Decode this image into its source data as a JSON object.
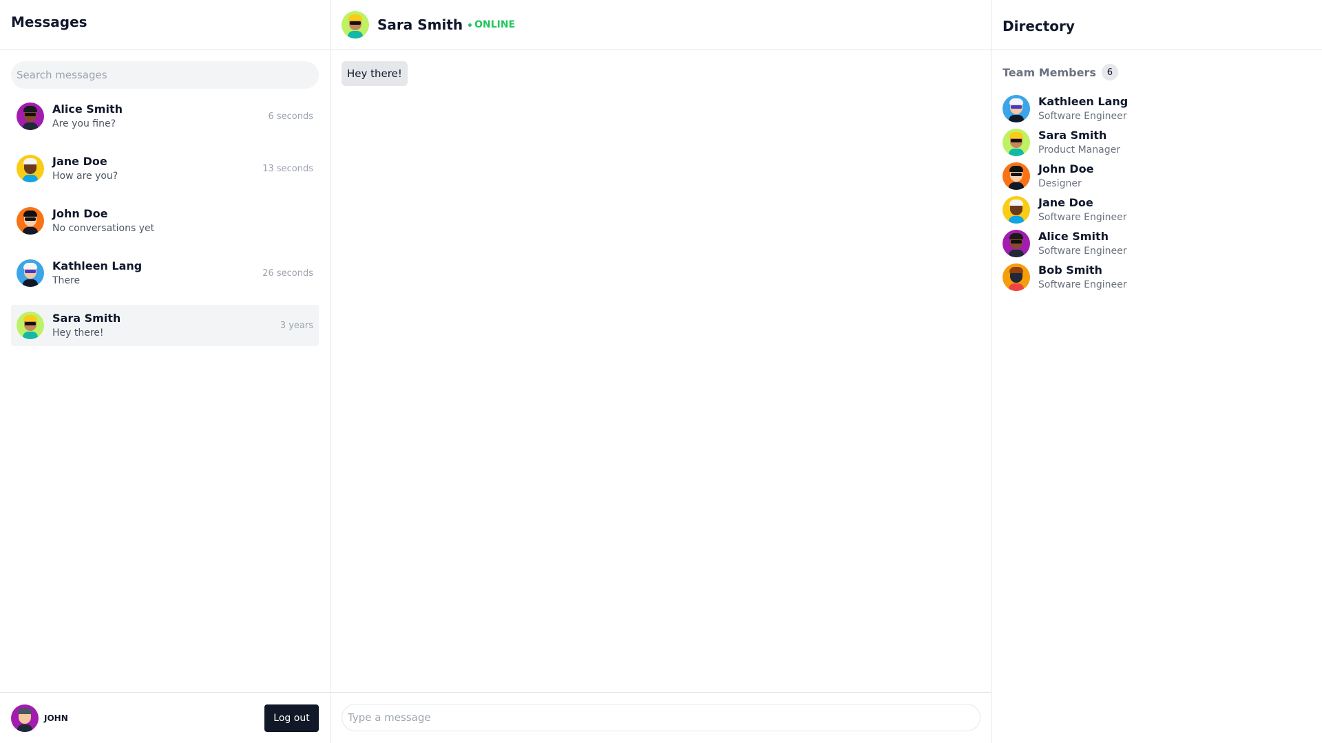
{
  "left": {
    "title": "Messages",
    "search_placeholder": "Search messages",
    "conversations": [
      {
        "name": "Alice Smith",
        "preview": "Are you fine?",
        "time": "6 seconds"
      },
      {
        "name": "Jane Doe",
        "preview": "How are you?",
        "time": "13 seconds"
      },
      {
        "name": "John Doe",
        "preview": "No conversations yet",
        "time": ""
      },
      {
        "name": "Kathleen Lang",
        "preview": "There",
        "time": "26 seconds"
      },
      {
        "name": "Sara Smith",
        "preview": "Hey there!",
        "time": "3 years"
      }
    ],
    "user": {
      "name": "JOHN"
    },
    "logout_label": "Log out"
  },
  "chat": {
    "contact_name": "Sara Smith",
    "status": "ONLINE",
    "messages": [
      {
        "text": "Hey there!"
      }
    ],
    "input_placeholder": "Type a message"
  },
  "directory": {
    "title": "Directory",
    "team_label": "Team Members",
    "team_count": "6",
    "members": [
      {
        "name": "Kathleen Lang",
        "role": "Software Engineer"
      },
      {
        "name": "Sara Smith",
        "role": "Product Manager"
      },
      {
        "name": "John Doe",
        "role": "Designer"
      },
      {
        "name": "Jane Doe",
        "role": "Software Engineer"
      },
      {
        "name": "Alice Smith",
        "role": "Software Engineer"
      },
      {
        "name": "Bob Smith",
        "role": "Software Engineer"
      }
    ]
  },
  "colors": {
    "online": "#22c55e",
    "avatar_alice": "#a21caf",
    "avatar_jane": "#facc15",
    "avatar_john": "#f97316",
    "avatar_kathleen": "#3ba5e8",
    "avatar_sara": "#bef264",
    "avatar_bob": "#f59e0b",
    "avatar_user": "#a21caf"
  }
}
